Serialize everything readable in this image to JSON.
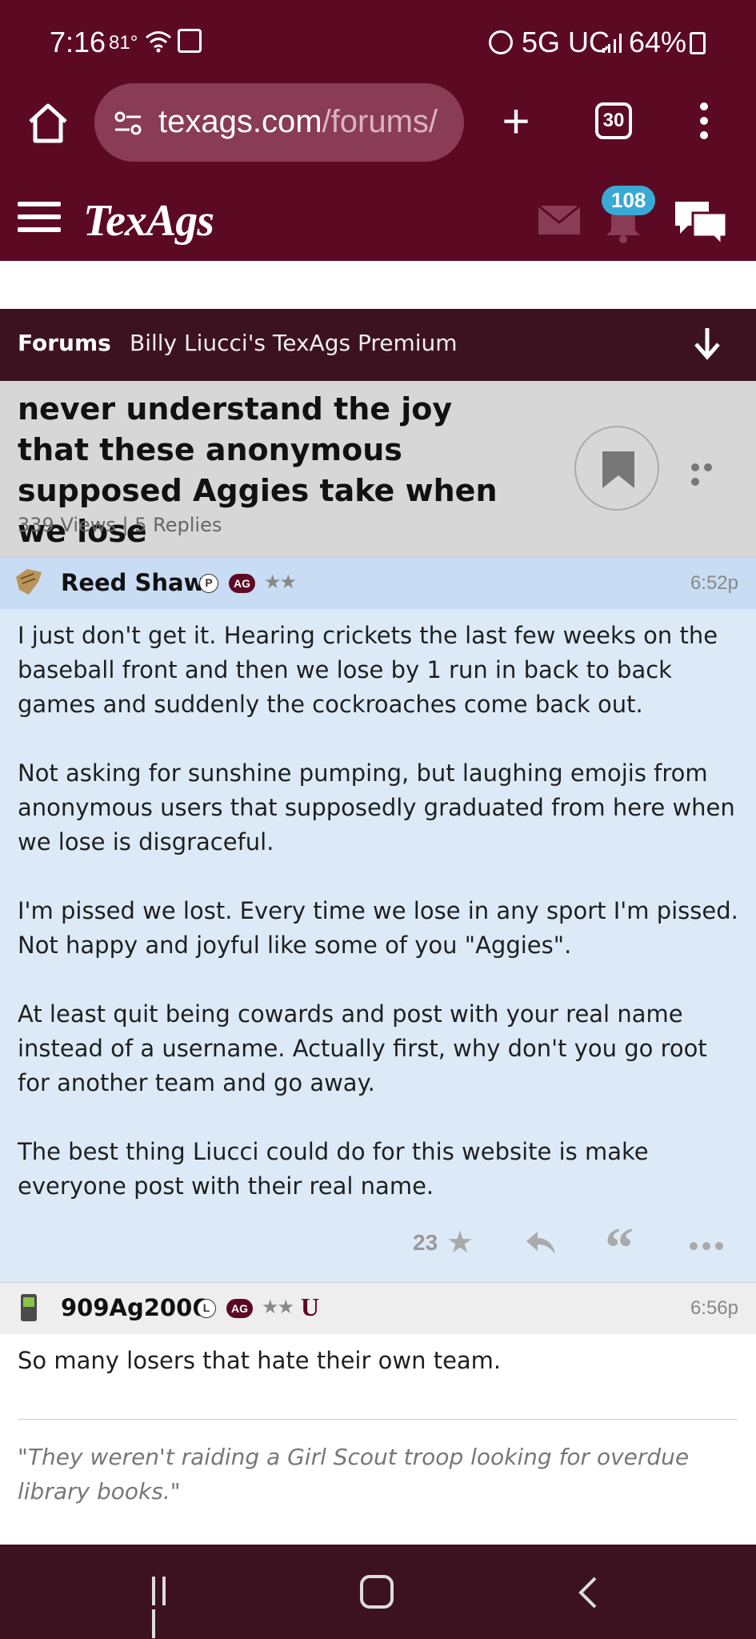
{
  "status_bar": {
    "time": "7:16",
    "temperature": "81°",
    "network": "5G UC",
    "battery": "64%"
  },
  "browser": {
    "url_host": "texags.com",
    "url_path": "/forums/",
    "tab_count": "30"
  },
  "site_header": {
    "logo": "TexAgs",
    "notifications_count": "108"
  },
  "breadcrumb": {
    "root": "Forums",
    "board": "Billy Liucci's TexAgs Premium"
  },
  "thread": {
    "title": "never understand the joy that these anonymous supposed Aggies take when we lose",
    "meta": "339 Views | 5 Replies"
  },
  "posts": [
    {
      "username": "Reed Shaw",
      "badge_letter": "P",
      "badge_ag": "AG",
      "stars": "★★",
      "time": "6:52p",
      "paragraphs": [
        "I just don't get it. Hearing crickets the last few weeks on the baseball front and then we lose by 1 run in back to back games and suddenly the cockroaches come back out.",
        "Not asking for sunshine pumping, but laughing emojis from anonymous users that supposedly graduated from here when we lose is disgraceful.",
        "I'm pissed we lost. Every time we lose in any sport I'm pissed. Not happy and joyful like some of you \"Aggies\".",
        "At least quit being cowards and post with your real name instead of a username. Actually first, why don't you go root for another team and go away.",
        "The best thing Liucci could do for this website is make everyone post with their real name."
      ],
      "star_count": "23"
    },
    {
      "username": "909Ag2006",
      "badge_letter": "L",
      "badge_ag": "AG",
      "stars": "★★",
      "u_badge": "U",
      "time": "6:56p",
      "body": "So many losers that hate their own team.",
      "signature": "\"They weren't raiding a Girl Scout troop looking for overdue library books.\""
    }
  ],
  "colors": {
    "maroon": "#5c0a24",
    "dark_maroon": "#3d1220",
    "post_blue": "#dceaf8",
    "badge_blue": "#3aa9d6"
  }
}
